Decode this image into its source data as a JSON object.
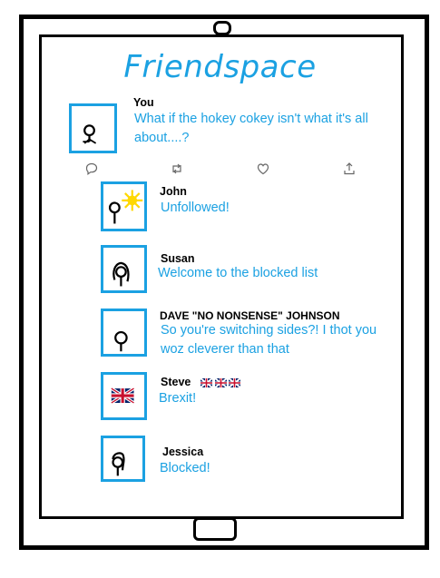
{
  "app": {
    "title": "Friendspace"
  },
  "main_post": {
    "author": "You",
    "text": "What if the hokey cokey isn't what it's all about....?",
    "icons": [
      "reply-icon",
      "retweet-icon",
      "like-icon",
      "share-icon"
    ]
  },
  "replies": [
    {
      "name": "John",
      "message": "Unfollowed!",
      "avatar": "stick-figure-sun"
    },
    {
      "name": "Susan",
      "message": "Welcome to the blocked list",
      "avatar": "stick-figure-long-hair"
    },
    {
      "name": "DAVE \"NO NONSENSE\" JOHNSON",
      "message": "So you're switching sides?! I thot you woz cleverer than that",
      "avatar": "stick-figure"
    },
    {
      "name": "Steve",
      "message": "Brexit!",
      "avatar": "union-jack-flag",
      "name_badges": "union-jack-flags x3"
    },
    {
      "name": "Jessica",
      "message": "Blocked!",
      "avatar": "stick-figure-hair"
    }
  ],
  "colors": {
    "accent": "#1ba1e2",
    "sun": "#ffd800",
    "flag_red": "#c8102e",
    "flag_blue": "#012169"
  }
}
